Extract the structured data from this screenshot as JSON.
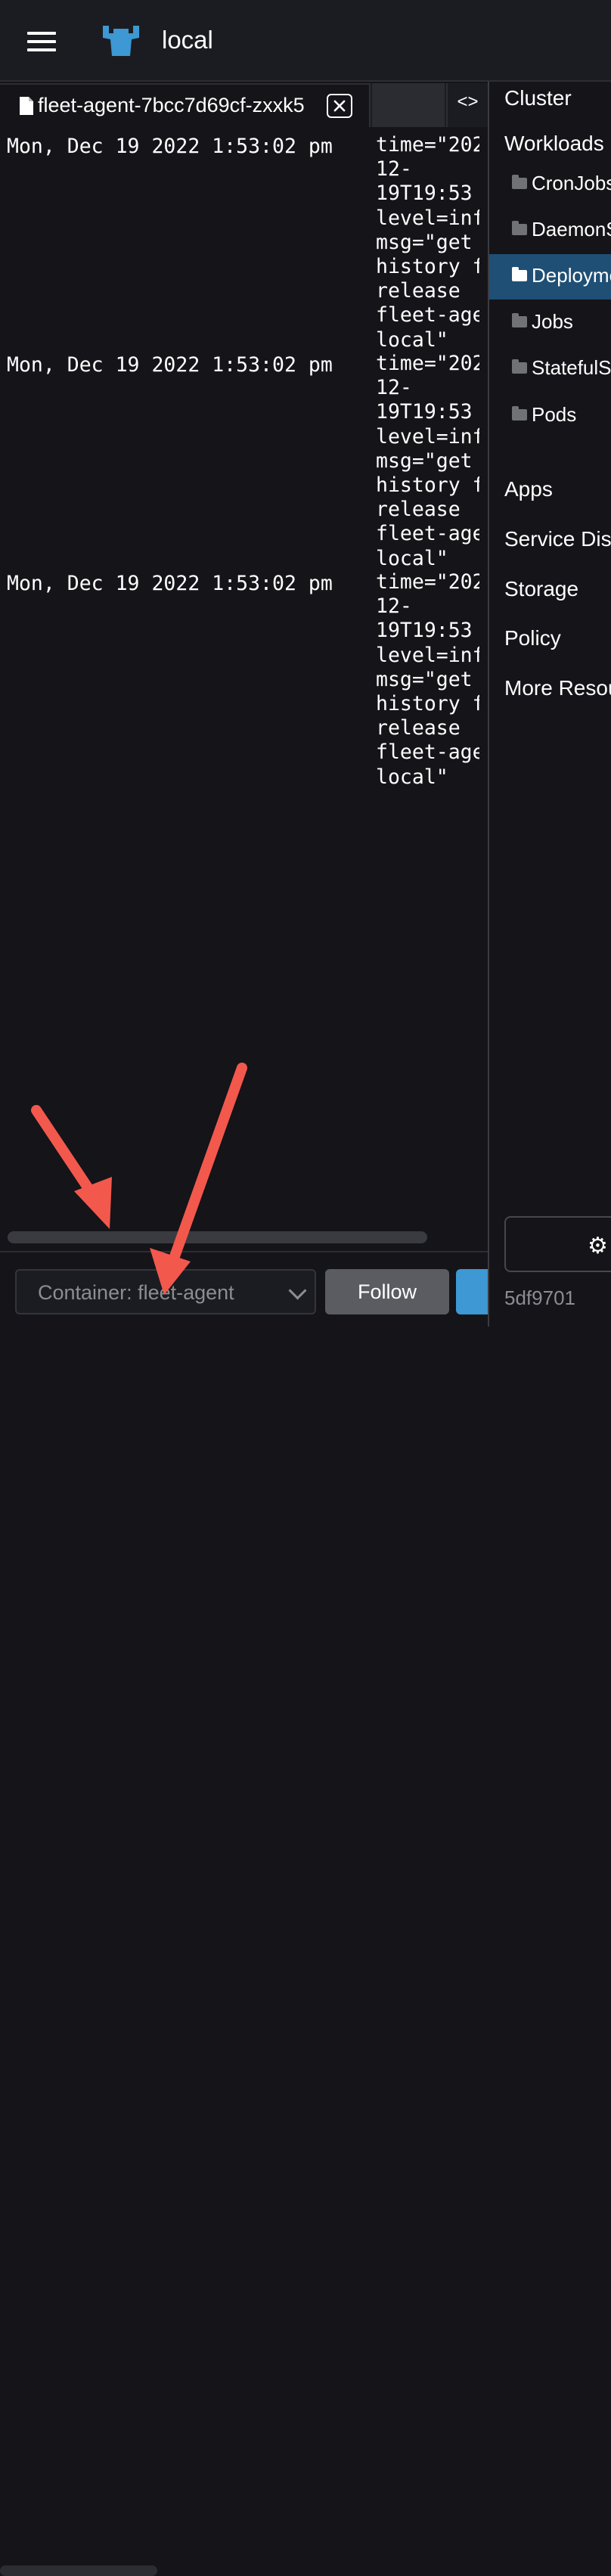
{
  "header": {
    "cluster_name": "local"
  },
  "tab": {
    "label": "fleet-agent-7bcc7d69cf-zxxk5",
    "expand_symbol": "<>"
  },
  "log": {
    "entries": [
      {
        "time": "Mon, Dec 19 2022 1:53:02 pm",
        "lines": [
          "time=\"202",
          "12-",
          "19T19:53",
          "level=inf",
          "msg=\"get",
          "history f",
          "release",
          "fleet-age",
          "local\""
        ]
      },
      {
        "time": "Mon, Dec 19 2022 1:53:02 pm",
        "lines": [
          "time=\"202",
          "12-",
          "19T19:53",
          "level=inf",
          "msg=\"get",
          "history f",
          "release",
          "fleet-age",
          "local\""
        ]
      },
      {
        "time": "Mon, Dec 19 2022 1:53:02 pm",
        "lines": [
          "time=\"202",
          "12-",
          "19T19:53",
          "level=inf",
          "msg=\"get",
          "history f",
          "release",
          "fleet-age",
          "local\""
        ]
      }
    ]
  },
  "footer": {
    "container_label": "Container: fleet-agent",
    "follow_label": "Follow"
  },
  "sidebar": {
    "cluster": "Cluster",
    "workloads": "Workloads",
    "sub": [
      "CronJobs",
      "DaemonSets",
      "Deployments",
      "Jobs",
      "StatefulSets",
      "Pods"
    ],
    "active_sub": "Deployments",
    "apps": "Apps",
    "service_discovery": "Service Discovery",
    "storage": "Storage",
    "policy": "Policy",
    "more_resources": "More Resources",
    "version": "5df9701"
  },
  "colors": {
    "active": "#1f4f74",
    "brand": "#3d98d3",
    "annotation_arrow": "#f3584c"
  }
}
